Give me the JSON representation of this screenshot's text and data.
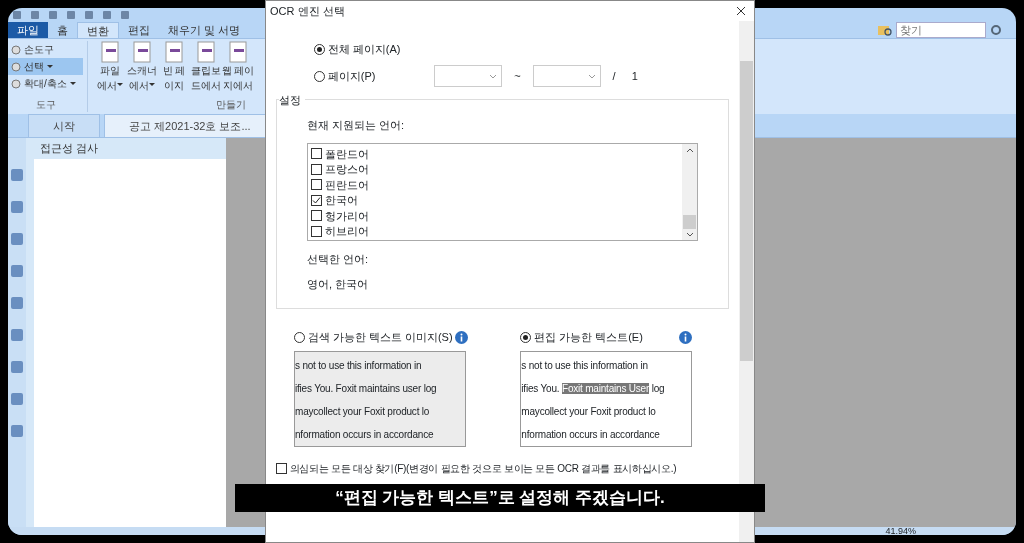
{
  "app": {
    "ribbon_tabs": [
      {
        "label": "파일",
        "kind": "file",
        "selected": false
      },
      {
        "label": "홈",
        "kind": "tab",
        "selected": false
      },
      {
        "label": "변환",
        "kind": "tab",
        "selected": true
      },
      {
        "label": "편집",
        "kind": "tab",
        "selected": false
      },
      {
        "label": "채우기 및 서명",
        "kind": "tab",
        "selected": false
      }
    ],
    "tools": [
      {
        "label": "손도구",
        "selected": false,
        "dropdown": false
      },
      {
        "label": "선택",
        "selected": true,
        "dropdown": true
      },
      {
        "label": "확대/축소",
        "selected": false,
        "dropdown": true
      }
    ],
    "tools_group": "도구",
    "create_buttons": [
      {
        "line1": "파일",
        "line2": "에서",
        "dropdown": true
      },
      {
        "line1": "스캐너",
        "line2": "에서",
        "dropdown": true
      },
      {
        "line1": "빈 페",
        "line2": "이지",
        "dropdown": false
      },
      {
        "line1": "클립보",
        "line2": "드에서",
        "dropdown": false
      },
      {
        "line1": "웹 페이",
        "line2": "지에서",
        "dropdown": false
      }
    ],
    "create_group": "만들기",
    "search": {
      "placeholder": "찾기"
    },
    "doc_tabs": [
      {
        "label": "시작",
        "selected": false
      },
      {
        "label": "공고 제2021-32호 보조...",
        "selected": true
      }
    ],
    "side_panel": {
      "title": "접근성 검사"
    },
    "status_bar": {
      "zoom": "41.94%"
    }
  },
  "dialog": {
    "title": "OCR 엔진 선택",
    "page_options": [
      {
        "label": "전체 페이지(A)",
        "selected": true,
        "kind": "plain"
      },
      {
        "label": "페이지(P)",
        "selected": false,
        "kind": "range"
      }
    ],
    "page_range": {
      "separator": "~",
      "slash": "/",
      "total": "1"
    },
    "settings": {
      "legend": "설정",
      "languages_label": "현재 지원되는 언어:",
      "languages": [
        {
          "label": "폴란드어",
          "checked": false
        },
        {
          "label": "프랑스어",
          "checked": false
        },
        {
          "label": "핀란드어",
          "checked": false
        },
        {
          "label": "한국어",
          "checked": true
        },
        {
          "label": "헝가리어",
          "checked": false
        },
        {
          "label": "히브리어",
          "checked": false
        }
      ],
      "selected_label": "선택한 언어:",
      "selected_value": "영어, 한국어"
    },
    "output_modes": [
      {
        "label": "검색 가능한 텍스트 이미지(S)",
        "selected": false,
        "kind": "image",
        "lines": [
          [
            {
              "text": "s not to use this information in",
              "highlight": false
            }
          ],
          [
            {
              "text": "ifies You. Foxit maintains user log",
              "highlight": false
            }
          ],
          [
            {
              "text": "maycollect your Foxit product lo",
              "highlight": false
            }
          ],
          [
            {
              "text": "nformation occurs in accordance",
              "highlight": false
            }
          ]
        ]
      },
      {
        "label": "편집 가능한 텍스트(E)",
        "selected": true,
        "kind": "editable",
        "lines": [
          [
            {
              "text": "s not to use this information in",
              "highlight": false
            }
          ],
          [
            {
              "text": "ifies You. ",
              "highlight": false
            },
            {
              "text": "Foxit maintains User",
              "highlight": true
            },
            {
              "text": " log",
              "highlight": false
            }
          ],
          [
            {
              "text": "maycollect your Foxit product lo",
              "highlight": false
            }
          ],
          [
            {
              "text": "nformation occurs in accordance",
              "highlight": false
            }
          ]
        ]
      }
    ],
    "options": [
      {
        "label": "의심되는 모든 대상 찾기(F)(변경이 필요한 것으로 보이는 모든 OCR 결과를 표시하십시오.)",
        "checked": false
      }
    ]
  },
  "caption": "“편집 가능한 텍스트”로 설정해 주겠습니다."
}
